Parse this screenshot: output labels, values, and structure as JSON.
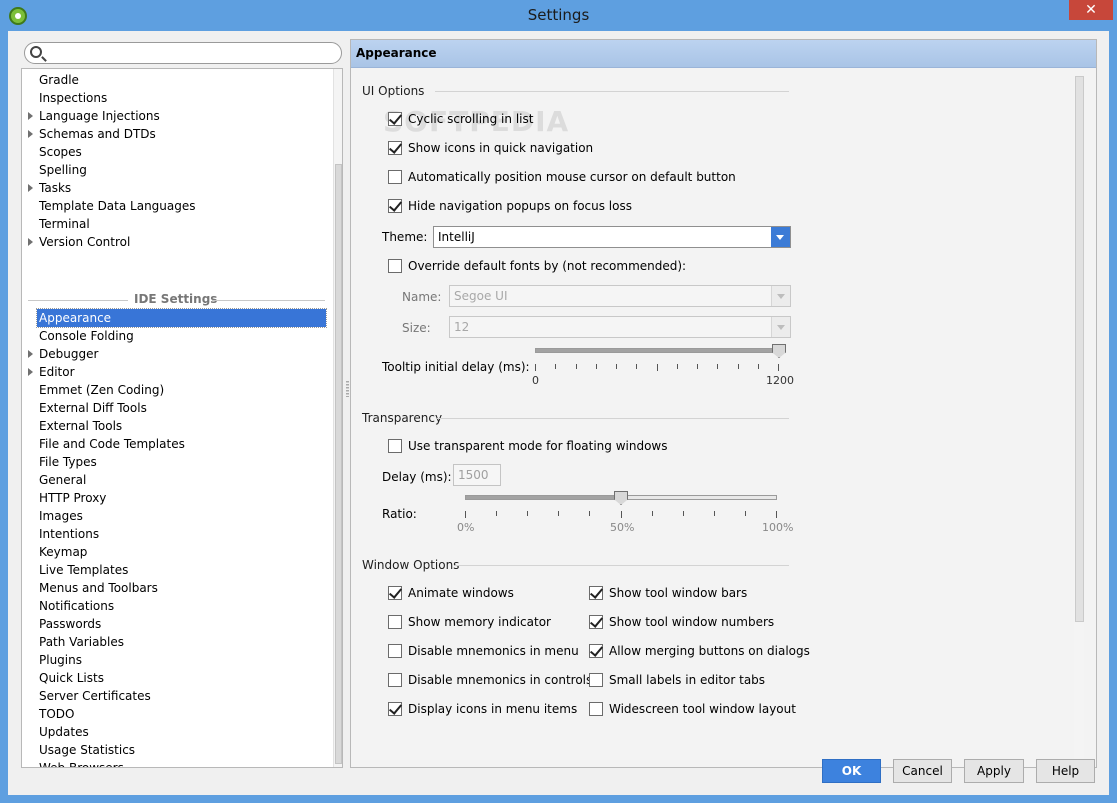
{
  "window": {
    "title": "Settings",
    "close_glyph": "✕"
  },
  "search": {
    "placeholder": "",
    "value": ""
  },
  "tree": {
    "items_top": [
      "Gradle",
      "Inspections",
      "Language Injections",
      "Schemas and DTDs",
      "Scopes",
      "Spelling",
      "Tasks",
      "Template Data Languages",
      "Terminal",
      "Version Control"
    ],
    "group_header": "IDE Settings",
    "items_ide": [
      "Appearance",
      "Console Folding",
      "Debugger",
      "Editor",
      "Emmet (Zen Coding)",
      "External Diff Tools",
      "External Tools",
      "File and Code Templates",
      "File Types",
      "General",
      "HTTP Proxy",
      "Images",
      "Intentions",
      "Keymap",
      "Live Templates",
      "Menus and Toolbars",
      "Notifications",
      "Passwords",
      "Path Variables",
      "Plugins",
      "Quick Lists",
      "Server Certificates",
      "TODO",
      "Updates",
      "Usage Statistics",
      "Web Browsers"
    ],
    "selected": "Appearance"
  },
  "page": {
    "title": "Appearance",
    "watermark": "SOFTPEDIA",
    "ui_options": {
      "section_title": "UI Options",
      "cyclic_scrolling": {
        "label": "Cyclic scrolling in list",
        "checked": true
      },
      "show_icons_quick_nav": {
        "label": "Show icons in quick navigation",
        "checked": true
      },
      "auto_position_mouse": {
        "label": "Automatically position mouse cursor on default button",
        "checked": false
      },
      "hide_nav_popups": {
        "label": "Hide navigation popups on focus loss",
        "checked": true
      },
      "theme_label": "Theme:",
      "theme_value": "IntelliJ",
      "override_fonts": {
        "label": "Override default fonts by (not recommended):",
        "checked": false
      },
      "name_label": "Name:",
      "name_value": "Segoe UI",
      "size_label": "Size:",
      "size_value": "12",
      "tooltip_label": "Tooltip initial delay (ms):",
      "tooltip_min": "0",
      "tooltip_max": "1200",
      "tooltip_value_fraction": 1.0
    },
    "transparency": {
      "section_title": "Transparency",
      "use_transparent": {
        "label": "Use transparent mode for floating windows",
        "checked": false
      },
      "delay_label": "Delay (ms):",
      "delay_value": "1500",
      "ratio_label": "Ratio:",
      "ratio_ticks": [
        "0%",
        "50%",
        "100%"
      ],
      "ratio_value_fraction": 0.5
    },
    "window_options": {
      "section_title": "Window Options",
      "left": [
        {
          "label": "Animate windows",
          "checked": true
        },
        {
          "label": "Show memory indicator",
          "checked": false
        },
        {
          "label": "Disable mnemonics in menu",
          "checked": false
        },
        {
          "label": "Disable mnemonics in controls",
          "checked": false
        },
        {
          "label": "Display icons in menu items",
          "checked": true
        }
      ],
      "right": [
        {
          "label": "Show tool window bars",
          "checked": true
        },
        {
          "label": "Show tool window numbers",
          "checked": true
        },
        {
          "label": "Allow merging buttons on dialogs",
          "checked": true
        },
        {
          "label": "Small labels in editor tabs",
          "checked": false
        },
        {
          "label": "Widescreen tool window layout",
          "checked": false
        }
      ]
    }
  },
  "buttons": {
    "ok": "OK",
    "cancel": "Cancel",
    "apply": "Apply",
    "help": "Help"
  },
  "colors": {
    "accent": "#3875d7",
    "titlebar": "#5e9fe0",
    "close": "#c7473a",
    "primary_button": "#3d82de"
  }
}
